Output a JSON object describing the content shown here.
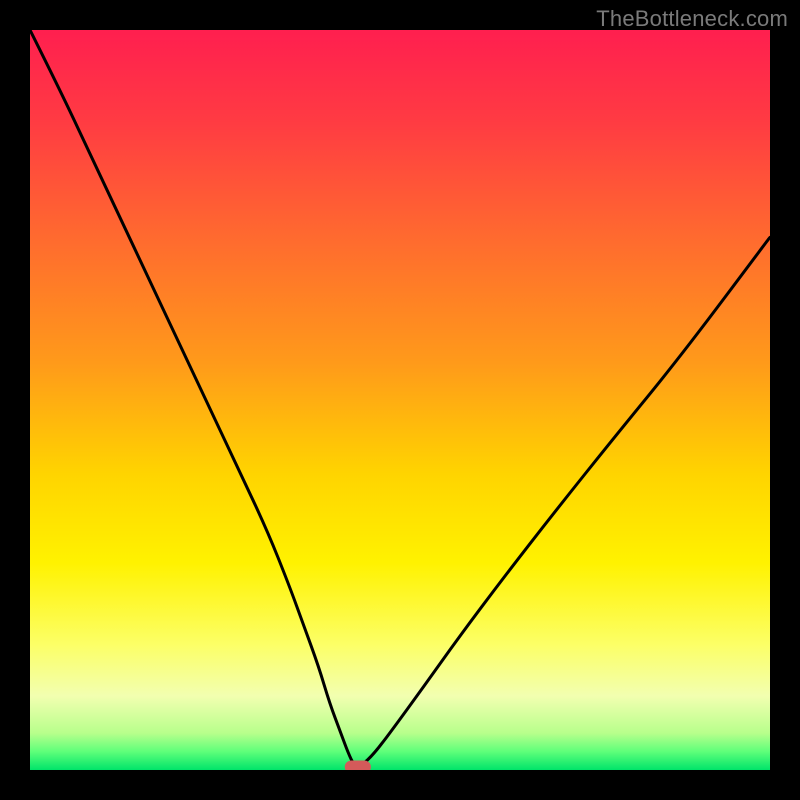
{
  "watermark": "TheBottleneck.com",
  "colors": {
    "frame": "#000000",
    "watermark": "#7a7a7a",
    "gradient_stops": [
      {
        "offset": 0.0,
        "color": "#ff1f4f"
      },
      {
        "offset": 0.12,
        "color": "#ff3a43"
      },
      {
        "offset": 0.28,
        "color": "#ff6a2f"
      },
      {
        "offset": 0.45,
        "color": "#ff9a1a"
      },
      {
        "offset": 0.6,
        "color": "#ffd400"
      },
      {
        "offset": 0.72,
        "color": "#fff200"
      },
      {
        "offset": 0.83,
        "color": "#fcff66"
      },
      {
        "offset": 0.9,
        "color": "#f2ffb0"
      },
      {
        "offset": 0.95,
        "color": "#b8ff8c"
      },
      {
        "offset": 0.975,
        "color": "#5fff7a"
      },
      {
        "offset": 1.0,
        "color": "#00e46a"
      }
    ],
    "curve": "#000000",
    "marker_fill": "#d45a5a",
    "marker_stroke": "#d45a5a"
  },
  "chart_data": {
    "type": "line",
    "title": "",
    "xlabel": "",
    "ylabel": "",
    "xlim": [
      0,
      100
    ],
    "ylim": [
      0,
      100
    ],
    "grid": false,
    "legend": false,
    "series": [
      {
        "name": "bottleneck-curve",
        "x": [
          0,
          4,
          8,
          12,
          16,
          20,
          24,
          28,
          32,
          35,
          37,
          39,
          40.5,
          42,
          43,
          43.8,
          44.8,
          46.5,
          49,
          53,
          58,
          64,
          71,
          79,
          88,
          100
        ],
        "y": [
          100,
          92,
          83.5,
          75,
          66.5,
          58,
          49.5,
          41,
          32.5,
          25,
          19.5,
          14,
          9,
          5,
          2.3,
          0.6,
          0.6,
          2.2,
          5.5,
          11,
          18,
          26,
          35,
          45,
          56,
          72
        ]
      }
    ],
    "annotations": [
      {
        "name": "optimum-marker",
        "x_center": 44.3,
        "width": 3.4,
        "y": 0.0
      }
    ]
  }
}
